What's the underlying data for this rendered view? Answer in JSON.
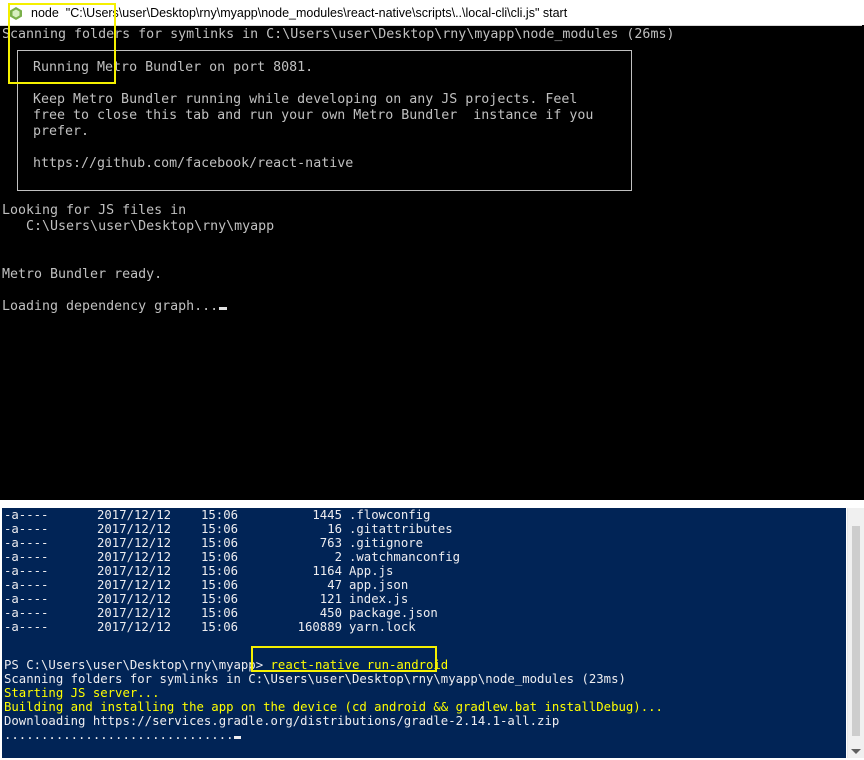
{
  "node_window": {
    "title": "node  \"C:\\Users\\user\\Desktop\\rny\\myapp\\node_modules\\react-native\\scripts\\..\\local-cli\\cli.js\" start",
    "scan_line": "Scanning folders for symlinks in C:\\Users\\user\\Desktop\\rny\\myapp\\node_modules (26ms)",
    "banner": {
      "line1": "Running Metro Bundler on port 8081.",
      "line2": "Keep Metro Bundler running while developing on any JS projects. Feel",
      "line3": "free to close this tab and run your own Metro Bundler  instance if you",
      "line4": "prefer.",
      "line5": "https://github.com/facebook/react-native"
    },
    "looking_line": "Looking for JS files in",
    "path_line": "   C:\\Users\\user\\Desktop\\rny\\myapp",
    "ready_line": "Metro Bundler ready.",
    "loading_line": "Loading dependency graph..."
  },
  "ps_window": {
    "files": [
      {
        "mode": "-a----",
        "date": "2017/12/12",
        "time": "15:06",
        "size": "1445",
        "name": ".flowconfig"
      },
      {
        "mode": "-a----",
        "date": "2017/12/12",
        "time": "15:06",
        "size": "16",
        "name": ".gitattributes"
      },
      {
        "mode": "-a----",
        "date": "2017/12/12",
        "time": "15:06",
        "size": "763",
        "name": ".gitignore"
      },
      {
        "mode": "-a----",
        "date": "2017/12/12",
        "time": "15:06",
        "size": "2",
        "name": ".watchmanconfig"
      },
      {
        "mode": "-a----",
        "date": "2017/12/12",
        "time": "15:06",
        "size": "1164",
        "name": "App.js"
      },
      {
        "mode": "-a----",
        "date": "2017/12/12",
        "time": "15:06",
        "size": "47",
        "name": "app.json"
      },
      {
        "mode": "-a----",
        "date": "2017/12/12",
        "time": "15:06",
        "size": "121",
        "name": "index.js"
      },
      {
        "mode": "-a----",
        "date": "2017/12/12",
        "time": "15:06",
        "size": "450",
        "name": "package.json"
      },
      {
        "mode": "-a----",
        "date": "2017/12/12",
        "time": "15:06",
        "size": "160889",
        "name": "yarn.lock"
      }
    ],
    "prompt": "PS C:\\Users\\user\\Desktop\\rny\\myapp> ",
    "command": "react-native run-android",
    "scan_line": "Scanning folders for symlinks in C:\\Users\\user\\Desktop\\rny\\myapp\\node_modules (23ms)",
    "starting_line": "Starting JS server...",
    "building_line": "Building and installing the app on the device (cd android && gradlew.bat installDebug)...",
    "downloading_line": "Downloading https://services.gradle.org/distributions/gradle-2.14.1-all.zip",
    "progress_line": "..............................."
  },
  "colors": {
    "ps_background": "#012456",
    "highlight": "#f5f000",
    "console_text": "#c0c0c0",
    "ps_yellow": "#ffff00"
  },
  "icons": {
    "node_icon": "node-app-icon"
  }
}
